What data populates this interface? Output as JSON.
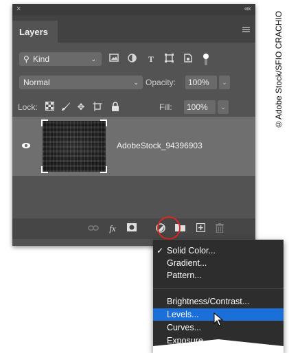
{
  "panel": {
    "close_glyph": "×",
    "collapse_glyph": "««",
    "tab_label": "Layers"
  },
  "filter": {
    "kind_label": "Kind",
    "icons": [
      "pixel-filter-icon",
      "adjustment-filter-icon",
      "type-filter-icon",
      "shape-filter-icon",
      "smart-object-filter-icon",
      "filter-toggle-icon"
    ]
  },
  "blending": {
    "mode": "Normal",
    "opacity_label": "Opacity:",
    "opacity_value": "100%"
  },
  "lock": {
    "label": "Lock:",
    "icons": [
      "lock-transparent-pixels-icon",
      "lock-image-pixels-icon",
      "lock-position-icon",
      "lock-artboard-icon",
      "lock-all-icon"
    ],
    "fill_label": "Fill:",
    "fill_value": "100%"
  },
  "layer": {
    "name": "AdobeStock_94396903",
    "visible": true
  },
  "bottom_icons": [
    "link-layers-icon",
    "layer-style-fx-icon",
    "add-mask-icon",
    "new-fill-adjustment-layer-icon",
    "new-group-folder-icon",
    "new-layer-icon",
    "delete-layer-icon"
  ],
  "menu": {
    "items": [
      "Solid Color...",
      "Gradient...",
      "Pattern...",
      "Brightness/Contrast...",
      "Levels...",
      "Curves...",
      "Exposure..."
    ],
    "checked": "Solid Color...",
    "highlighted": "Levels..."
  },
  "colors": {
    "panel_bg": "#535353",
    "selected_layer_bg": "#6f6f6f",
    "menu_highlight": "#1a6fd8",
    "highlight_circle": "#e0261f"
  },
  "credit": "©Adobe Stock/SFIO CRACHIO"
}
